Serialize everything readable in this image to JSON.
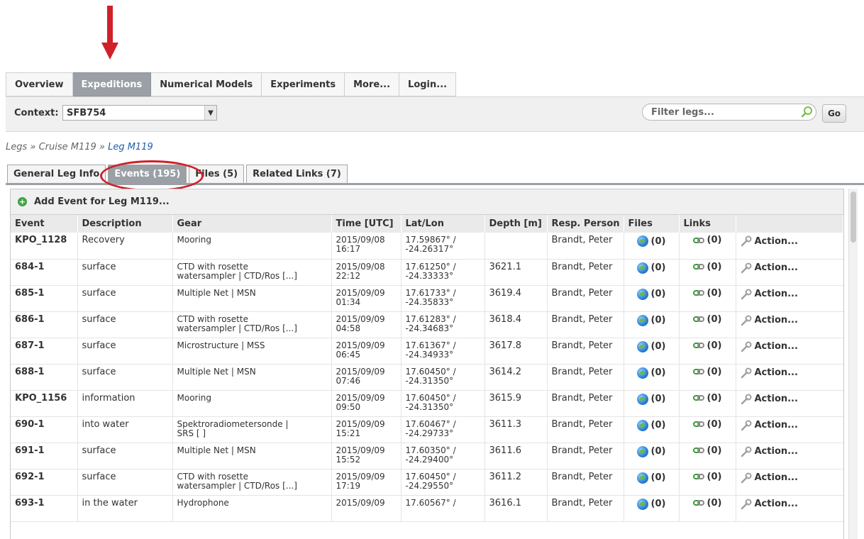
{
  "colors": {
    "annotation_red": "#d0202a",
    "active_tab": "#9aa0a6",
    "link_blue": "#1f5fa8"
  },
  "topnav": [
    {
      "label": "Overview",
      "active": false
    },
    {
      "label": "Expeditions",
      "active": true
    },
    {
      "label": "Numerical Models",
      "active": false
    },
    {
      "label": "Experiments",
      "active": false
    },
    {
      "label": "More...",
      "active": false
    },
    {
      "label": "Login...",
      "active": false
    }
  ],
  "context": {
    "label": "Context:",
    "value": "SFB754"
  },
  "filter": {
    "placeholder": "Filter legs...",
    "go_label": "Go"
  },
  "breadcrumb": {
    "part1": "Legs",
    "sep": " » ",
    "part2": "Cruise M119",
    "part3": "Leg M119"
  },
  "subtabs": [
    {
      "label": "General Leg Info",
      "active": false
    },
    {
      "label": "Events (195)",
      "active": true
    },
    {
      "label": "Files (5)",
      "active": false
    },
    {
      "label": "Related Links (7)",
      "active": false
    }
  ],
  "add_event_label": "Add Event for Leg M119...",
  "table": {
    "headers": [
      "Event",
      "Description",
      "Gear",
      "Time [UTC]",
      "Lat/Lon",
      "Depth [m]",
      "Resp. Person",
      "Files",
      "Links",
      ""
    ],
    "files_count": "(0)",
    "links_count": "(0)",
    "action_label": "Action...",
    "rows": [
      {
        "event": "KPO_1128",
        "desc": "Recovery",
        "gear1": "Mooring",
        "gear2": "",
        "date": "2015/09/08",
        "time": "16:17",
        "lat": "17.59867° /",
        "lon": "-24.26317°",
        "depth": "",
        "person": "Brandt, Peter"
      },
      {
        "event": "684-1",
        "desc": "surface",
        "gear1": "CTD with rosette",
        "gear2": "watersampler | CTD/Ros [...]",
        "date": "2015/09/08",
        "time": "22:12",
        "lat": "17.61250° /",
        "lon": "-24.33333°",
        "depth": "3621.1",
        "person": "Brandt, Peter"
      },
      {
        "event": "685-1",
        "desc": "surface",
        "gear1": "Multiple Net | MSN",
        "gear2": "",
        "date": "2015/09/09",
        "time": "01:34",
        "lat": "17.61733° /",
        "lon": "-24.35833°",
        "depth": "3619.4",
        "person": "Brandt, Peter"
      },
      {
        "event": "686-1",
        "desc": "surface",
        "gear1": "CTD with rosette",
        "gear2": "watersampler | CTD/Ros [...]",
        "date": "2015/09/09",
        "time": "04:58",
        "lat": "17.61283° /",
        "lon": "-24.34683°",
        "depth": "3618.4",
        "person": "Brandt, Peter"
      },
      {
        "event": "687-1",
        "desc": "surface",
        "gear1": "Microstructure | MSS",
        "gear2": "",
        "date": "2015/09/09",
        "time": "06:45",
        "lat": "17.61367° /",
        "lon": "-24.34933°",
        "depth": "3617.8",
        "person": "Brandt, Peter"
      },
      {
        "event": "688-1",
        "desc": "surface",
        "gear1": "Multiple Net | MSN",
        "gear2": "",
        "date": "2015/09/09",
        "time": "07:46",
        "lat": "17.60450° /",
        "lon": "-24.31350°",
        "depth": "3614.2",
        "person": "Brandt, Peter"
      },
      {
        "event": "KPO_1156",
        "desc": "information",
        "gear1": "Mooring",
        "gear2": "",
        "date": "2015/09/09",
        "time": "09:50",
        "lat": "17.60450° /",
        "lon": "-24.31350°",
        "depth": "3615.9",
        "person": "Brandt, Peter"
      },
      {
        "event": "690-1",
        "desc": "into water",
        "gear1": "Spektroradiometersonde |",
        "gear2": "SRS [ ]",
        "date": "2015/09/09",
        "time": "15:21",
        "lat": "17.60467° /",
        "lon": "-24.29733°",
        "depth": "3611.3",
        "person": "Brandt, Peter"
      },
      {
        "event": "691-1",
        "desc": "surface",
        "gear1": "Multiple Net | MSN",
        "gear2": "",
        "date": "2015/09/09",
        "time": "15:52",
        "lat": "17.60350° /",
        "lon": "-24.29400°",
        "depth": "3611.6",
        "person": "Brandt, Peter"
      },
      {
        "event": "692-1",
        "desc": "surface",
        "gear1": "CTD with rosette",
        "gear2": "watersampler | CTD/Ros [...]",
        "date": "2015/09/09",
        "time": "17:19",
        "lat": "17.60450° /",
        "lon": "-24.29550°",
        "depth": "3611.2",
        "person": "Brandt, Peter"
      },
      {
        "event": "693-1",
        "desc": "in the water",
        "gear1": "Hydrophone",
        "gear2": "",
        "date": "2015/09/09",
        "time": "",
        "lat": "17.60567° /",
        "lon": "",
        "depth": "3616.1",
        "person": "Brandt, Peter"
      }
    ]
  }
}
